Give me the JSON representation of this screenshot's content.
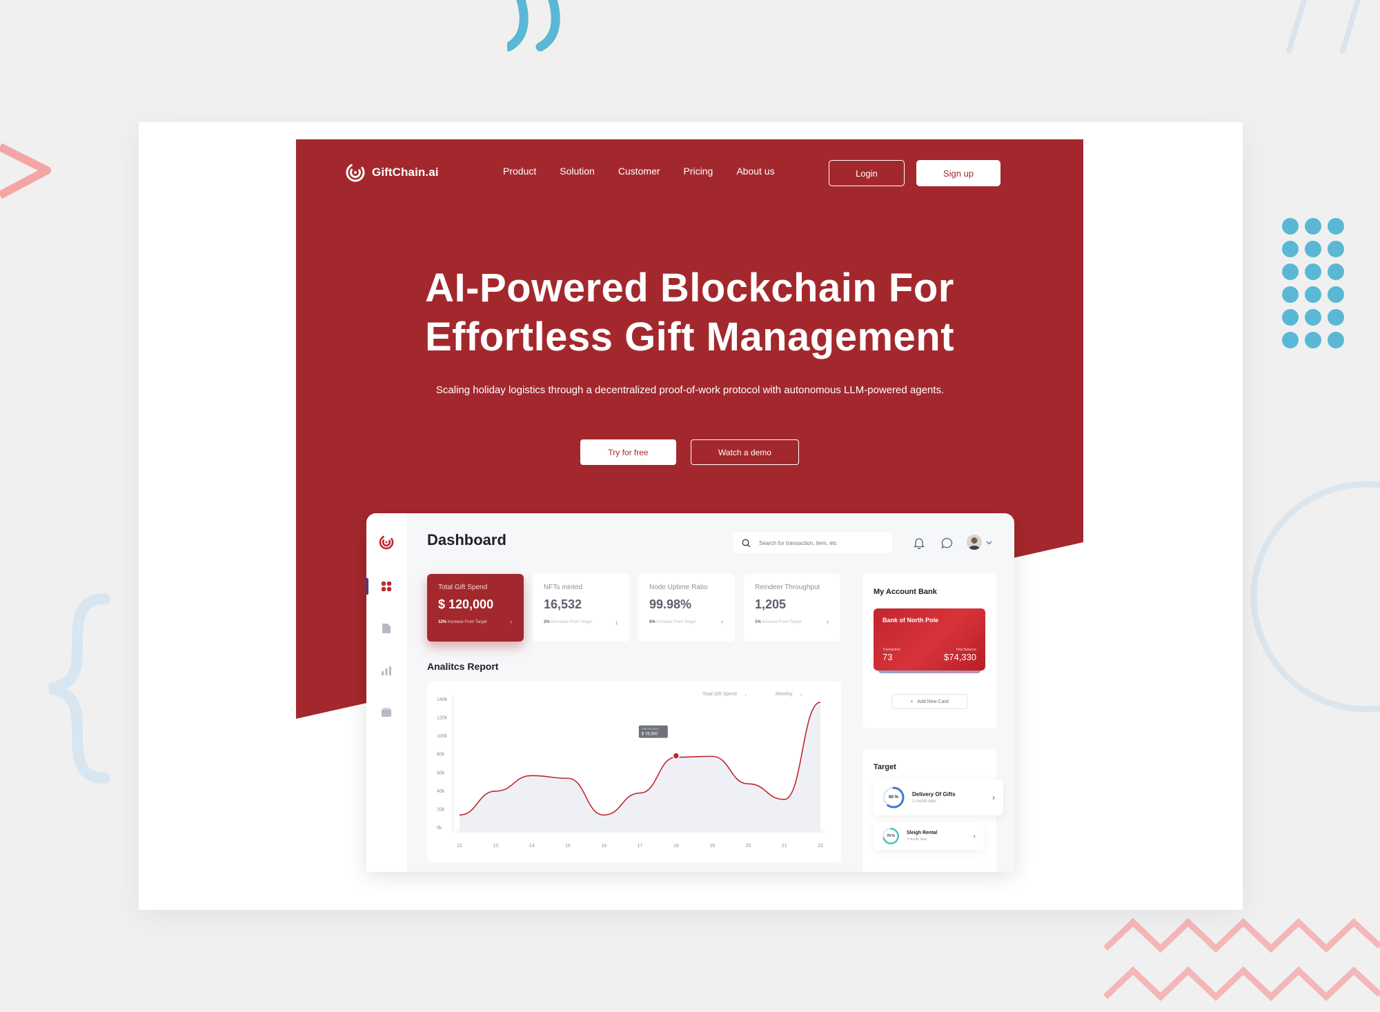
{
  "brand": {
    "name": "GiftChain.ai",
    "accent": "#a3282d"
  },
  "nav": {
    "items": [
      "Product",
      "Solution",
      "Customer",
      "Pricing",
      "About us"
    ],
    "login": "Login",
    "signup": "Sign up"
  },
  "hero": {
    "title_line1": "AI-Powered Blockchain For",
    "title_line2": "Effortless Gift Management",
    "subtitle": "Scaling holiday logistics through a decentralized proof-of-work protocol with autonomous LLM-powered agents.",
    "cta_primary": "Try for free",
    "cta_secondary": "Watch a demo"
  },
  "dashboard": {
    "title": "Dashboard",
    "search_placeholder": "Search for transaction, item, etc",
    "sidebar_icons": [
      "dashboard-grid-icon",
      "document-icon",
      "bar-chart-icon",
      "wallet-icon"
    ],
    "stats": [
      {
        "label": "Total Gift Spend",
        "value": "$ 120,000",
        "delta": "12%",
        "delta_text": "Increase From Target",
        "direction": "up"
      },
      {
        "label": "NFTs minted",
        "value": "16,532",
        "delta": "2%",
        "delta_text": "Decrease From Target",
        "direction": "down"
      },
      {
        "label": "Node Uptime Ratio",
        "value": "99.98%",
        "delta": "6%",
        "delta_text": "Increase From Target",
        "direction": "up"
      },
      {
        "label": "Reindeer Throughput",
        "value": "1,205",
        "delta": "1%",
        "delta_text": "Increase From Target",
        "direction": "up"
      }
    ],
    "analytics": {
      "title": "Analitcs Report",
      "series_selector": "Total Gift Spend",
      "period_selector": "Monthly",
      "tooltip_label": "Total Gift Spend",
      "tooltip_value": "$ 78,560"
    },
    "account": {
      "title": "My Account Bank",
      "card_bank": "Bank of North Pole",
      "transaction_label": "Transaction",
      "transaction_value": "73",
      "balance_label": "Total Balance",
      "balance_value": "$74,330",
      "add_card": "Add New Card"
    },
    "target": {
      "title": "Target",
      "items": [
        {
          "name": "Delivery Of Gifts",
          "sub": "1 month later",
          "percent": 60,
          "percent_label": "60 %",
          "color": "#3a7bd5"
        },
        {
          "name": "Sleigh Rental",
          "sub": "3 month later",
          "percent": 70,
          "percent_label": "70 %",
          "color": "#35c3c1"
        }
      ]
    }
  },
  "chart_data": {
    "type": "area",
    "x": [
      12,
      13,
      14,
      15,
      16,
      17,
      18,
      19,
      20,
      21,
      22
    ],
    "series": [
      {
        "values": [
          14000,
          40000,
          57000,
          54000,
          14000,
          38000,
          77000,
          78000,
          48000,
          31000,
          137000
        ]
      }
    ],
    "yticks": [
      "0k",
      "20k",
      "40k",
      "60k",
      "80k",
      "100k",
      "120k",
      "140k"
    ],
    "xlabel": "",
    "ylabel": "",
    "ylim": [
      0,
      140000
    ],
    "highlight": {
      "x": 18,
      "y": 78560
    },
    "line_color": "#c0272d"
  }
}
